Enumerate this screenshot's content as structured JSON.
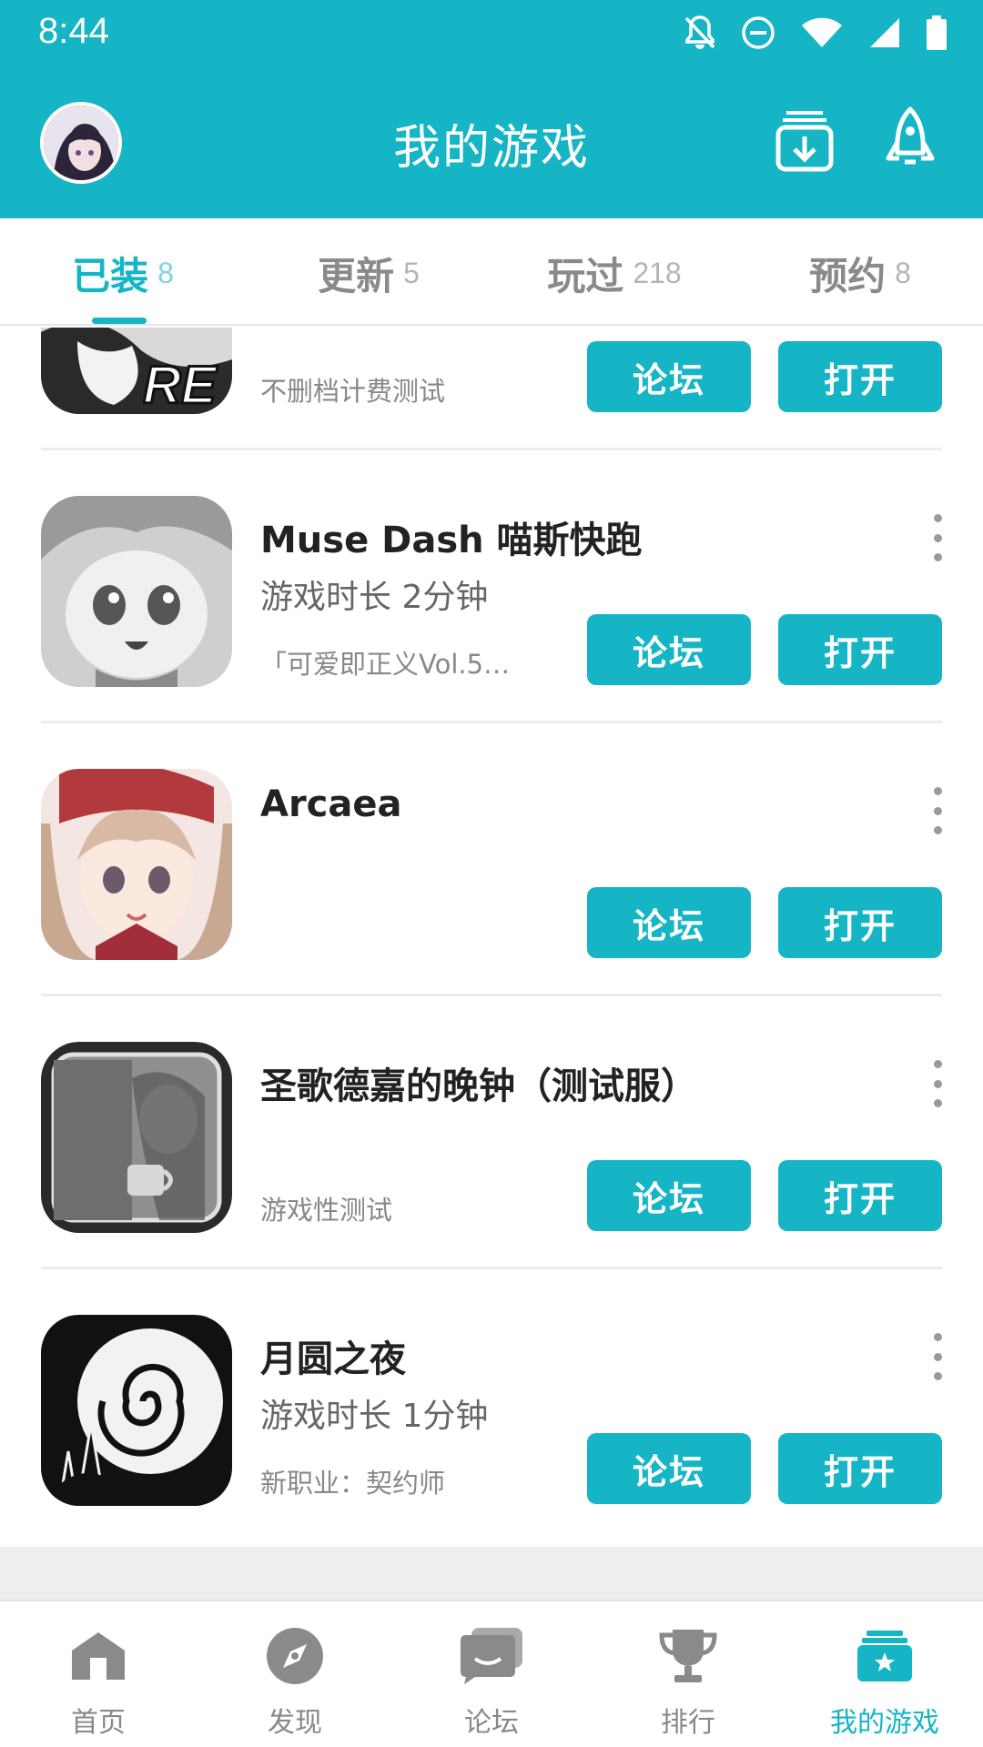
{
  "status_bar": {
    "time": "8:44",
    "icons": [
      "notifications-off-icon",
      "do-not-disturb-icon",
      "wifi-icon",
      "signal-icon",
      "battery-icon"
    ]
  },
  "app_bar": {
    "title": "我的游戏",
    "left_icon": "avatar",
    "right_icons": [
      "download-manager-icon",
      "rocket-icon"
    ]
  },
  "tabs": [
    {
      "label": "已装",
      "count": "8",
      "active": true
    },
    {
      "label": "更新",
      "count": "5",
      "active": false
    },
    {
      "label": "玩过",
      "count": "218",
      "active": false
    },
    {
      "label": "预约",
      "count": "8",
      "active": false
    }
  ],
  "games": [
    {
      "title": "",
      "playtime": "",
      "note": "不删档计费测试",
      "icon": "re-game-icon"
    },
    {
      "title": "Muse Dash 喵斯快跑",
      "playtime": "游戏时长 2分钟",
      "note": "「可爱即正义Vol.5」…",
      "icon": "muse-dash-icon"
    },
    {
      "title": "Arcaea",
      "playtime": "",
      "note": "",
      "icon": "arcaea-icon"
    },
    {
      "title": "圣歌德嘉的晚钟（测试服）",
      "playtime": "",
      "note": "游戏性测试",
      "icon": "bell-game-icon"
    },
    {
      "title": "月圆之夜",
      "playtime": "游戏时长 1分钟",
      "note": "新职业：契约师",
      "icon": "full-moon-night-icon"
    }
  ],
  "buttons": {
    "forum": "论坛",
    "open": "打开"
  },
  "bottom_nav": [
    {
      "label": "首页",
      "icon": "home-icon",
      "active": false
    },
    {
      "label": "发现",
      "icon": "compass-icon",
      "active": false
    },
    {
      "label": "论坛",
      "icon": "chat-icon",
      "active": false
    },
    {
      "label": "排行",
      "icon": "trophy-icon",
      "active": false
    },
    {
      "label": "我的游戏",
      "icon": "my-games-icon",
      "active": true
    }
  ],
  "colors": {
    "accent": "#15b5c6",
    "inactive": "#888888"
  }
}
